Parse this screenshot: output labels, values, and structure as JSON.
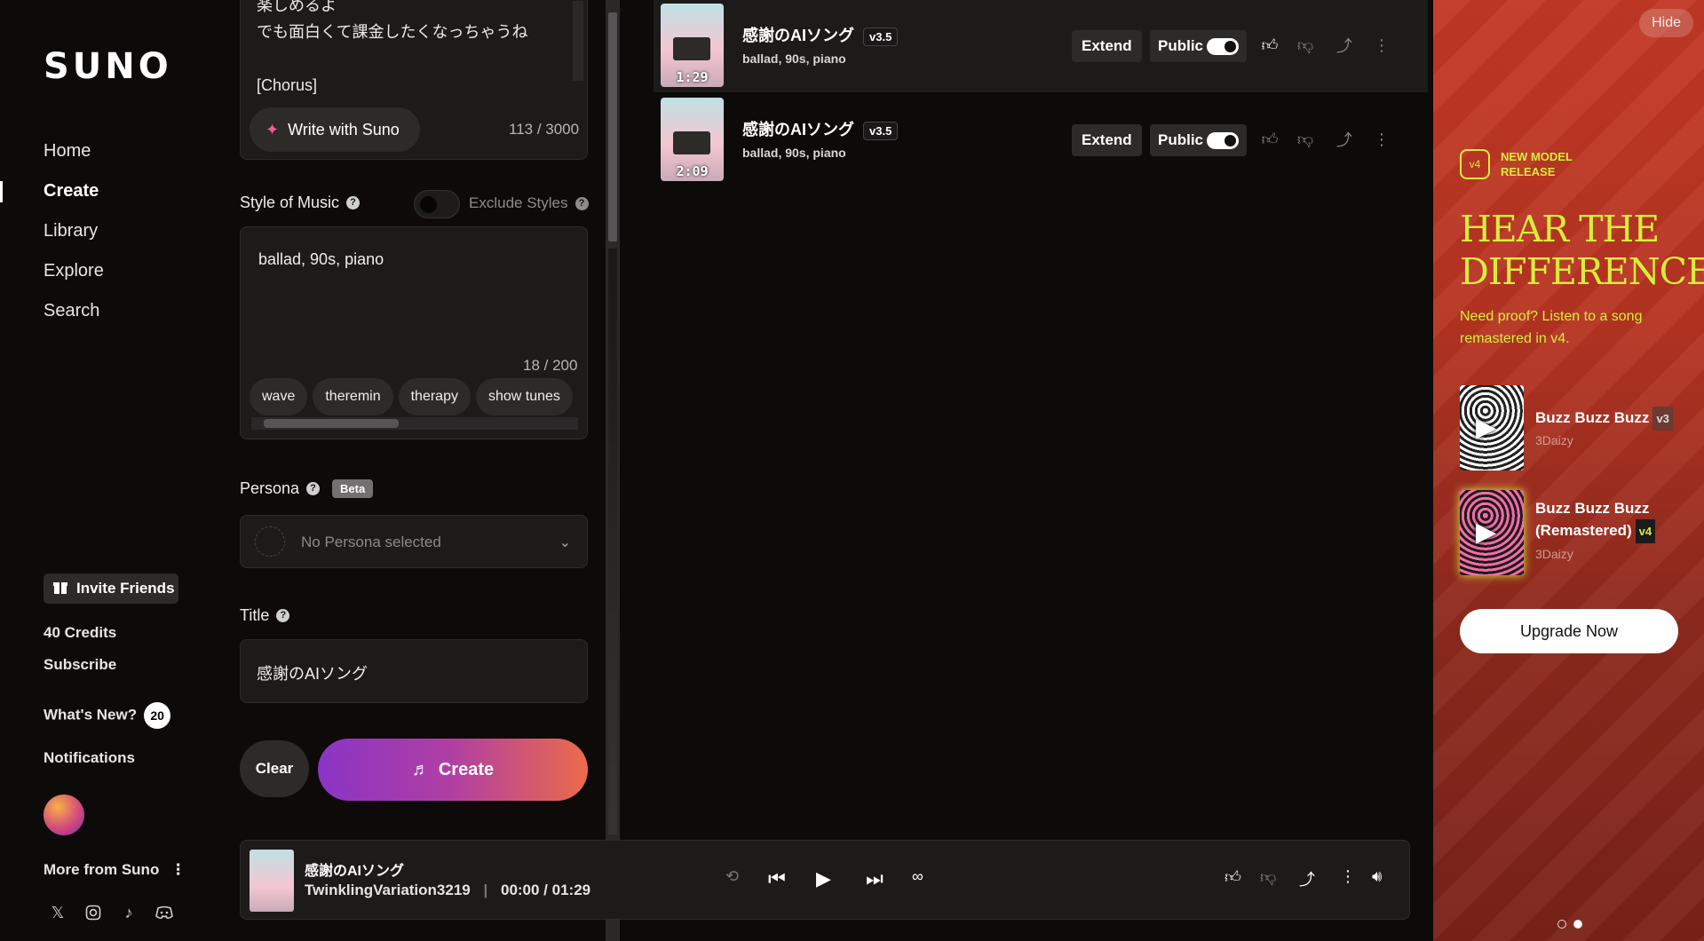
{
  "brand": {
    "logo": "SUNO"
  },
  "nav": [
    {
      "label": "Home"
    },
    {
      "label": "Create"
    },
    {
      "label": "Library"
    },
    {
      "label": "Explore"
    },
    {
      "label": "Search"
    }
  ],
  "sidebar": {
    "invite": "Invite Friends",
    "credits": "40 Credits",
    "subscribe": "Subscribe",
    "whats_new": "What's New?",
    "whats_new_count": "20",
    "notifications": "Notifications",
    "more": "More from Suno"
  },
  "create": {
    "lyrics": "楽しめるよ\nでも面白くて課金したくなっちゃうね\n\n[Chorus]",
    "write_btn": "Write with Suno",
    "lyrics_counter": "113 / 3000",
    "style_label": "Style of Music",
    "exclude_label": "Exclude Styles",
    "style_value": "ballad, 90s, piano",
    "style_counter": "18 / 200",
    "chips": [
      "wave",
      "theremin",
      "therapy",
      "show tunes"
    ],
    "persona_label": "Persona",
    "persona_badge": "Beta",
    "persona_value": "No Persona selected",
    "title_label": "Title",
    "title_value": "感謝のAIソング",
    "clear_btn": "Clear",
    "create_btn": "Create"
  },
  "songs": [
    {
      "title": "感謝のAIソング",
      "version": "v3.5",
      "tags": "ballad, 90s, piano",
      "duration": "1:29",
      "extend": "Extend",
      "public": "Public",
      "liked": true
    },
    {
      "title": "感謝のAIソング",
      "version": "v3.5",
      "tags": "ballad, 90s, piano",
      "duration": "2:09",
      "extend": "Extend",
      "public": "Public",
      "liked": false
    }
  ],
  "player": {
    "title": "感謝のAIソング",
    "artist": "TwinklingVariation3219",
    "time": "00:00 / 01:29"
  },
  "promo": {
    "hide": "Hide",
    "badge": "v4",
    "kicker": "NEW MODEL\nRELEASE",
    "headline": "HEAR THE\nDIFFERENCE",
    "sub": "Need proof? Listen to a song remastered in v4.",
    "songs": [
      {
        "title": "Buzz Buzz Buzz",
        "version": "v3",
        "artist": "3Daizy"
      },
      {
        "title": "Buzz Buzz Buzz\n(Remastered)",
        "version": "v4",
        "artist": "3Daizy"
      }
    ],
    "upgrade": "Upgrade Now"
  },
  "colors": {
    "accent": "#d6ee3b",
    "promo_bg": "#b63422",
    "panel": "#1d1b1a"
  }
}
